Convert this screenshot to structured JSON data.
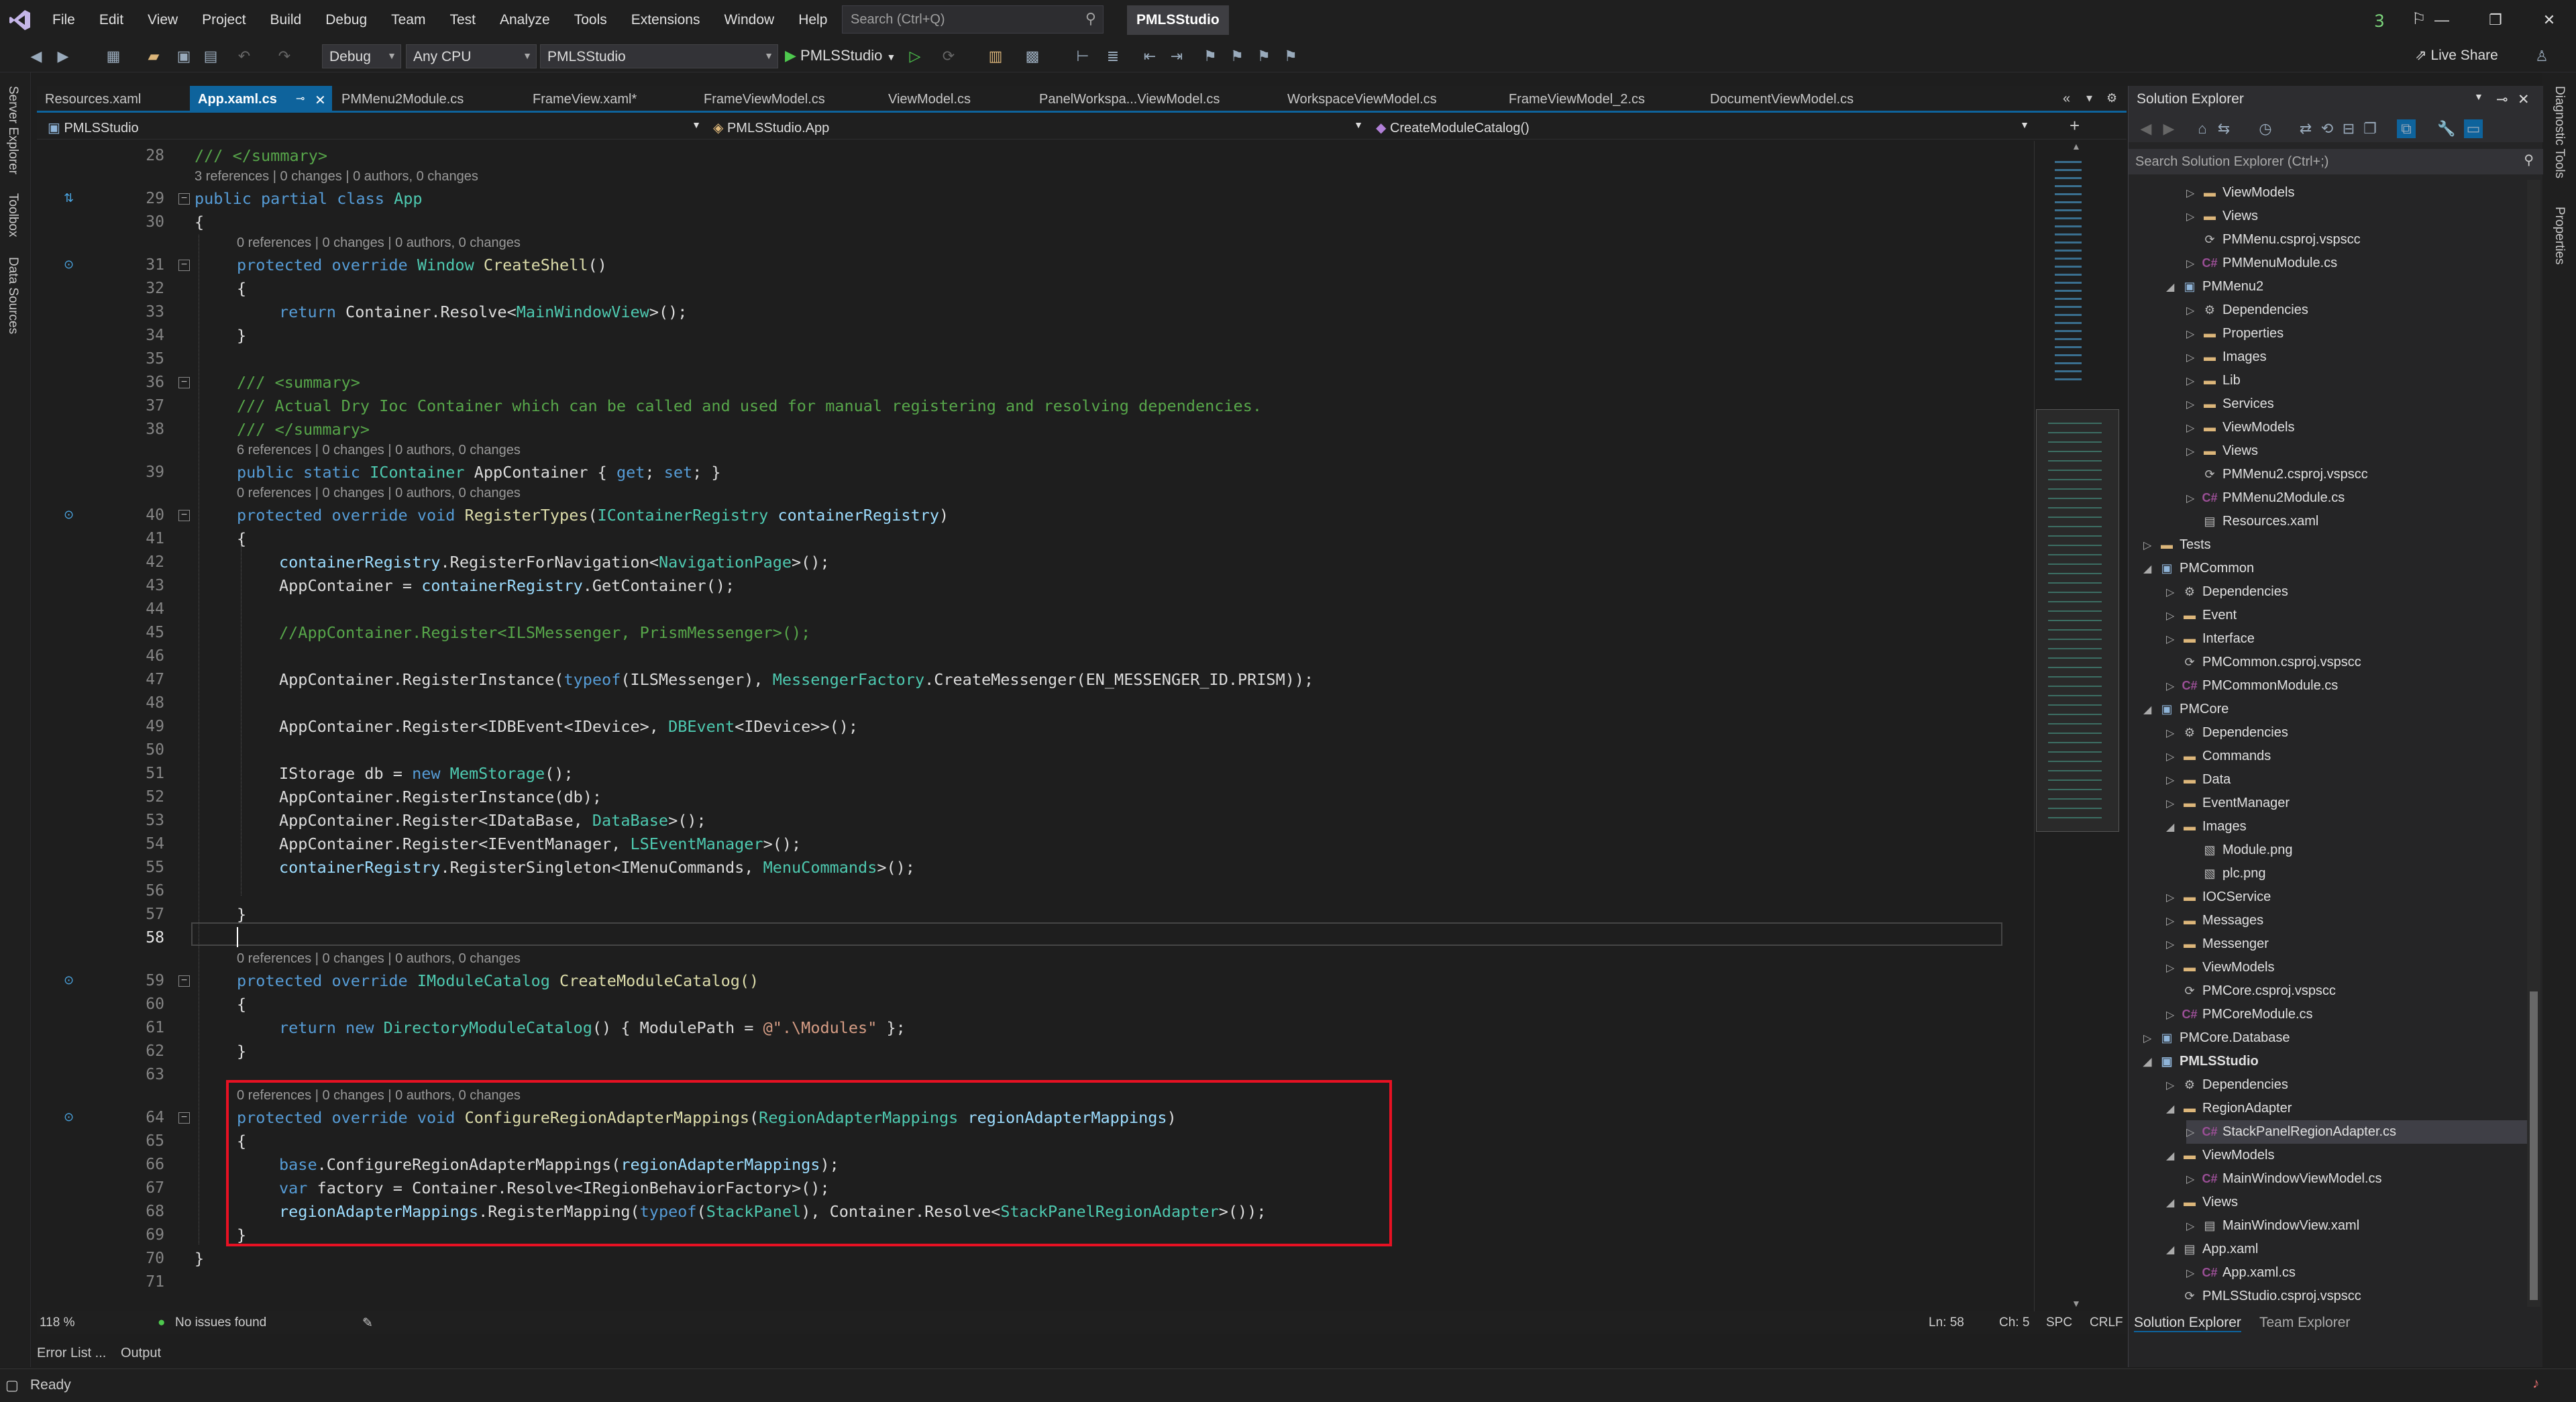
{
  "menu": [
    "File",
    "Edit",
    "View",
    "Project",
    "Build",
    "Debug",
    "Team",
    "Test",
    "Analyze",
    "Tools",
    "Extensions",
    "Window",
    "Help"
  ],
  "search": {
    "placeholder": "Search (Ctrl+Q)"
  },
  "solution_name": "PMLSStudio",
  "toolbar": {
    "config": "Debug",
    "platform": "Any CPU",
    "project": "PMLSStudio",
    "run_label": "PMLSStudio",
    "live_share": "Live Share"
  },
  "side_tabs": {
    "left": [
      "Server Explorer",
      "Toolbox",
      "Data Sources"
    ],
    "right": [
      "Diagnostic Tools",
      "Properties"
    ]
  },
  "tabs": [
    "Resources.xaml",
    "App.xaml.cs",
    "PMMenu2Module.cs",
    "FrameView.xaml*",
    "FrameViewModel.cs",
    "ViewModel.cs",
    "PanelWorkspa...ViewModel.cs",
    "WorkspaceViewModel.cs",
    "FrameViewModel_2.cs",
    "DocumentViewModel.cs"
  ],
  "nav": {
    "project": "PMLSStudio",
    "class": "PMLSStudio.App",
    "member": "CreateModuleCatalog()"
  },
  "code": {
    "l28": "/// </summary>",
    "lens1": "3 references | 0 changes | 0 authors, 0 changes",
    "l29a": "public partial class ",
    "l29b": "App",
    "l30": "{",
    "lens2": "0 references | 0 changes | 0 authors, 0 changes",
    "l31a": "protected override ",
    "l31b": "Window",
    "l31c": " CreateShell",
    "l31d": "()",
    "l32": "{",
    "l33a": "return ",
    "l33b": "Container",
    "l33c": ".Resolve<",
    "l33d": "MainWindowView",
    "l33e": ">();",
    "l34": "}",
    "l36": "/// <summary>",
    "l37": "/// Actual Dry Ioc Container which can be called and used for manual registering and resolving dependencies.",
    "l38": "/// </summary>",
    "lens3": "6 references | 0 changes | 0 authors, 0 changes",
    "l39a": "public static ",
    "l39b": "IContainer",
    "l39c": " AppContainer { ",
    "l39d": "get",
    "l39e": "; ",
    "l39f": "set",
    "l39g": "; }",
    "lens4": "0 references | 0 changes | 0 authors, 0 changes",
    "l40a": "protected override void ",
    "l40b": "RegisterTypes",
    "l40c": "(",
    "l40d": "IContainerRegistry",
    "l40e": " containerRegistry",
    "l40f": ")",
    "l41": "{",
    "l42a": "containerRegistry",
    "l42b": ".RegisterForNavigation<",
    "l42c": "NavigationPage",
    "l42d": ">();",
    "l43a": "AppContainer = ",
    "l43b": "containerRegistry",
    "l43c": ".GetContainer();",
    "l45": "//AppContainer.Register<ILSMessenger, PrismMessenger>();",
    "l47a": "AppContainer.RegisterInstance(",
    "l47b": "typeof",
    "l47c": "(ILSMessenger), ",
    "l47d": "MessengerFactory",
    "l47e": ".CreateMessenger(EN_MESSENGER_ID.PRISM));",
    "l49a": "AppContainer.Register<IDBEvent<IDevice>, ",
    "l49b": "DBEvent",
    "l49c": "<IDevice>>();",
    "l51a": "IStorage db = ",
    "l51b": "new ",
    "l51c": "MemStorage",
    "l51d": "();",
    "l52": "AppContainer.RegisterInstance(db);",
    "l53a": "AppContainer.Register<IDataBase, ",
    "l53b": "DataBase",
    "l53c": ">();",
    "l54a": "AppContainer.Register<IEventManager, ",
    "l54b": "LSEventManager",
    "l54c": ">();",
    "l55a": "containerRegistry",
    "l55b": ".RegisterSingleton<IMenuCommands, ",
    "l55c": "MenuCommands",
    "l55d": ">();",
    "l57": "}",
    "lens5": "0 references | 0 changes | 0 authors, 0 changes",
    "l59a": "protected override ",
    "l59b": "IModuleCatalog",
    "l59c": " CreateModuleCatalog()",
    "l60": "{",
    "l61a": "return ",
    "l61b": "new ",
    "l61c": "DirectoryModuleCatalog",
    "l61d": "() { ModulePath = ",
    "l61e": "@\".\\Modules\"",
    "l61f": " };",
    "l62": "}",
    "lens6": "0 references | 0 changes | 0 authors, 0 changes",
    "l64a": "protected override void ",
    "l64b": "ConfigureRegionAdapterMappings",
    "l64c": "(",
    "l64d": "RegionAdapterMappings",
    "l64e": " regionAdapterMappings",
    "l64f": ")",
    "l65": "{",
    "l66a": "base",
    "l66b": ".ConfigureRegionAdapterMappings(",
    "l66c": "regionAdapterMappings",
    "l66d": ");",
    "l67a": "var ",
    "l67b": "factory = ",
    "l67c": "Container",
    "l67d": ".Resolve<IRegionBehaviorFactory>();",
    "l68a": "regionAdapterMappings",
    "l68b": ".RegisterMapping(",
    "l68c": "typeof",
    "l68d": "(",
    "l68e": "StackPanel",
    "l68f": "), Container.Resolve<",
    "l68g": "StackPanelRegionAdapter",
    "l68h": ">());",
    "l69": "}",
    "l70": "}"
  },
  "line_numbers": [
    "28",
    "29",
    "30",
    "31",
    "32",
    "33",
    "34",
    "35",
    "36",
    "37",
    "38",
    "39",
    "40",
    "41",
    "42",
    "43",
    "44",
    "45",
    "46",
    "47",
    "48",
    "49",
    "50",
    "51",
    "52",
    "53",
    "54",
    "55",
    "56",
    "57",
    "58",
    "59",
    "60",
    "61",
    "62",
    "63",
    "64",
    "65",
    "66",
    "67",
    "68",
    "69",
    "70",
    "71"
  ],
  "editor_status": {
    "zoom": "118 %",
    "issues": "No issues found",
    "ln": "Ln: 58",
    "ch": "Ch: 5",
    "spc": "SPC",
    "crlf": "CRLF"
  },
  "bottom_tabs": [
    "Error List ...",
    "Output"
  ],
  "status": "Ready",
  "solution_explorer": {
    "title": "Solution Explorer",
    "search_placeholder": "Search Solution Explorer (Ctrl+;)",
    "bottom_tabs": [
      "Solution Explorer",
      "Team Explorer"
    ],
    "items": [
      "ViewModels",
      "Views",
      "PMMenu.csproj.vspscc",
      "PMMenuModule.cs",
      "PMMenu2",
      "Dependencies",
      "Properties",
      "Images",
      "Lib",
      "Services",
      "ViewModels",
      "Views",
      "PMMenu2.csproj.vspscc",
      "PMMenu2Module.cs",
      "Resources.xaml",
      "Tests",
      "PMCommon",
      "Dependencies",
      "Event",
      "Interface",
      "PMCommon.csproj.vspscc",
      "PMCommonModule.cs",
      "PMCore",
      "Dependencies",
      "Commands",
      "Data",
      "EventManager",
      "Images",
      "Module.png",
      "plc.png",
      "IOCService",
      "Messages",
      "Messenger",
      "ViewModels",
      "PMCore.csproj.vspscc",
      "PMCoreModule.cs",
      "PMCore.Database",
      "PMLSStudio",
      "Dependencies",
      "RegionAdapter",
      "StackPanelRegionAdapter.cs",
      "ViewModels",
      "MainWindowViewModel.cs",
      "Views",
      "MainWindowView.xaml",
      "App.xaml",
      "App.xaml.cs",
      "PMLSStudio.csproj.vspscc"
    ]
  }
}
